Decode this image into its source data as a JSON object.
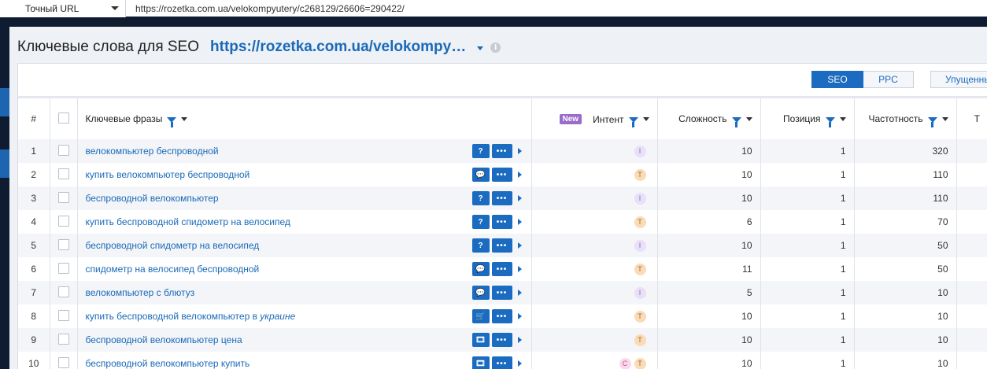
{
  "topbar": {
    "url_mode": "Точный URL",
    "url_value": "https://rozetka.com.ua/velokompyutery/c268129/26606=290422/"
  },
  "header": {
    "title": "Ключевые слова для SEO",
    "domain": "https://rozetka.com.ua/velokompy…",
    "info_icon": "i"
  },
  "toolbar": {
    "tabs": [
      {
        "label": "SEO",
        "active": true
      },
      {
        "label": "PPC",
        "active": false
      }
    ],
    "advanced_label": "Упущенные"
  },
  "table": {
    "columns": {
      "index": "#",
      "keywords": "Ключевые фразы",
      "new_badge": "New",
      "intent": "Интент",
      "difficulty": "Сложность",
      "position": "Позиция",
      "frequency": "Частотность",
      "next": "Т"
    },
    "rows": [
      {
        "n": "1",
        "keyword": "велокомпьютер беспроводной",
        "keyword_italic": "",
        "serp_icon": "?",
        "intents": [
          "I"
        ],
        "difficulty": "10",
        "position": "1",
        "frequency": "320"
      },
      {
        "n": "2",
        "keyword": "купить велокомпьютер беспроводной",
        "keyword_italic": "",
        "serp_icon": "💬",
        "intents": [
          "T"
        ],
        "difficulty": "10",
        "position": "1",
        "frequency": "110"
      },
      {
        "n": "3",
        "keyword": "беспроводной велокомпьютер",
        "keyword_italic": "",
        "serp_icon": "?",
        "intents": [
          "I"
        ],
        "difficulty": "10",
        "position": "1",
        "frequency": "110"
      },
      {
        "n": "4",
        "keyword": "купить беспроводной спидометр на велосипед",
        "keyword_italic": "",
        "serp_icon": "?",
        "intents": [
          "T"
        ],
        "difficulty": "6",
        "position": "1",
        "frequency": "70"
      },
      {
        "n": "5",
        "keyword": "беспроводной спидометр на велосипед",
        "keyword_italic": "",
        "serp_icon": "?",
        "intents": [
          "I"
        ],
        "difficulty": "10",
        "position": "1",
        "frequency": "50"
      },
      {
        "n": "6",
        "keyword": "спидометр на велосипед беспроводной",
        "keyword_italic": "",
        "serp_icon": "💬",
        "intents": [
          "T"
        ],
        "difficulty": "11",
        "position": "1",
        "frequency": "50"
      },
      {
        "n": "7",
        "keyword": "велокомпьютер с блютуз",
        "keyword_italic": "",
        "serp_icon": "💬",
        "intents": [
          "I"
        ],
        "difficulty": "5",
        "position": "1",
        "frequency": "10"
      },
      {
        "n": "8",
        "keyword": "купить беспроводной велокомпьютер в ",
        "keyword_italic": "украине",
        "serp_icon": "🛒",
        "intents": [
          "T"
        ],
        "difficulty": "10",
        "position": "1",
        "frequency": "10"
      },
      {
        "n": "9",
        "keyword": "беспроводной велокомпьютер цена",
        "keyword_italic": "",
        "serp_icon": "🎞",
        "intents": [
          "T"
        ],
        "difficulty": "10",
        "position": "1",
        "frequency": "10"
      },
      {
        "n": "10",
        "keyword": "беспроводной велокомпьютер купить",
        "keyword_italic": "",
        "serp_icon": "🎞",
        "intents": [
          "C",
          "T"
        ],
        "difficulty": "10",
        "position": "1",
        "frequency": "10"
      }
    ]
  },
  "icons": {
    "more": "•••",
    "filter": "filter-icon",
    "sort": "sort-caret-icon"
  },
  "colors": {
    "accent": "#1b6bc0",
    "link": "#1a6ab8",
    "new_badge": "#9b6bc9",
    "nav_dark": "#0e1b31"
  }
}
